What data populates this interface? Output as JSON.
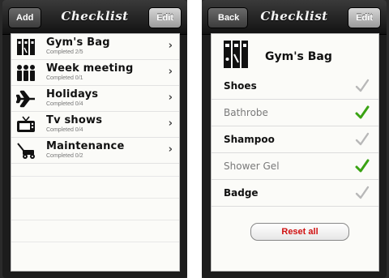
{
  "left_screen": {
    "nav": {
      "left_button": "Add",
      "title": "Checklist",
      "right_button": "Edit"
    },
    "lists": [
      {
        "name": "Gym's Bag",
        "status": "Completed 2/5",
        "icon": "gym-bag-icon"
      },
      {
        "name": "Week meeting",
        "status": "Completed 0/1",
        "icon": "people-icon"
      },
      {
        "name": "Holidays",
        "status": "Completed 0/4",
        "icon": "airplane-icon"
      },
      {
        "name": "Tv shows",
        "status": "Completed 0/4",
        "icon": "tv-icon"
      },
      {
        "name": "Maintenance",
        "status": "Completed 0/2",
        "icon": "lawnmower-icon"
      }
    ]
  },
  "right_screen": {
    "nav": {
      "left_button": "Back",
      "title": "Checklist",
      "right_button": "Edit"
    },
    "header": {
      "title": "Gym's Bag",
      "icon": "gym-bag-icon"
    },
    "items": [
      {
        "label": "Shoes",
        "checked": false
      },
      {
        "label": "Bathrobe",
        "checked": true
      },
      {
        "label": "Shampoo",
        "checked": false
      },
      {
        "label": "Shower Gel",
        "checked": true
      },
      {
        "label": "Badge",
        "checked": false
      }
    ],
    "reset_label": "Reset all"
  },
  "colors": {
    "check_done": "#3aa313",
    "check_todo": "#b8b8b8",
    "reset_text": "#d01010"
  }
}
